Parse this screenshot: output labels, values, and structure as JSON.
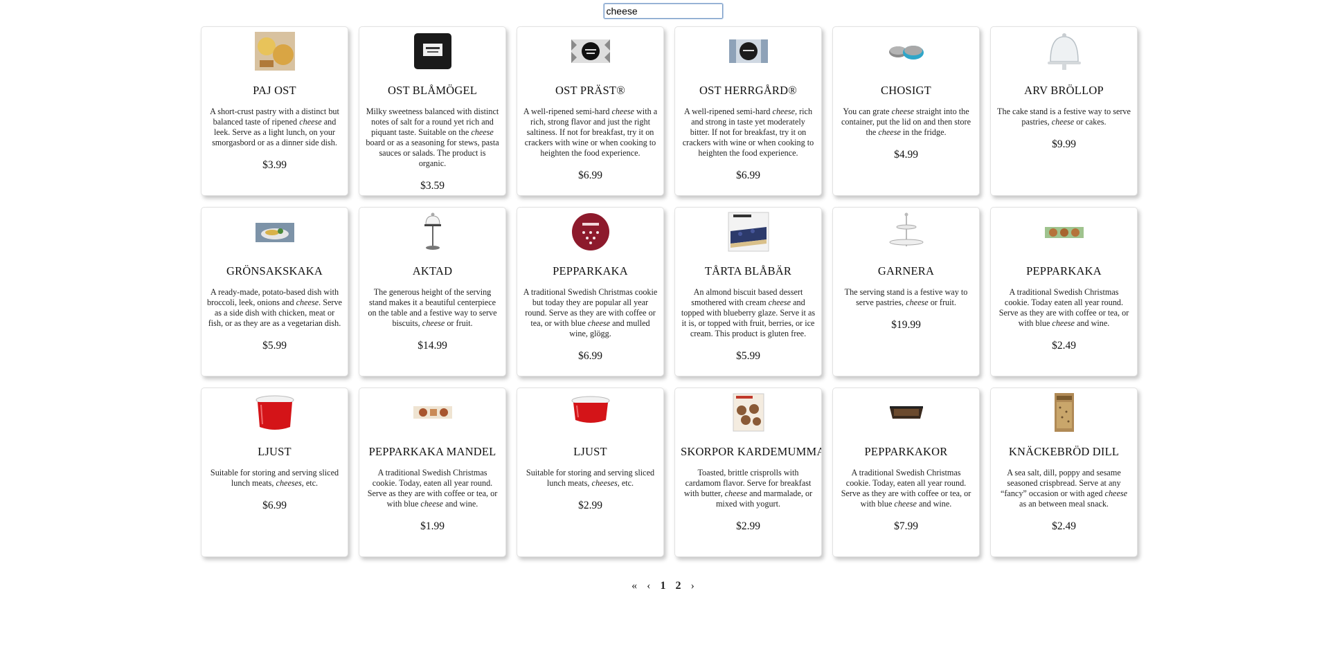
{
  "search": {
    "value": "cheese"
  },
  "products": [
    {
      "title": "PAJ OST",
      "price": "$3.99",
      "icon": "quiche-image",
      "desc": [
        [
          "A short-crust pastry with a distinct but balanced taste of ripened ",
          false
        ],
        [
          "cheese",
          true
        ],
        [
          " and leek. Serve as a light lunch, on your smorgasbord or as a dinner side dish.",
          false
        ]
      ]
    },
    {
      "title": "OST BLÅMÖGEL",
      "price": "$3.59",
      "icon": "blue-cheese-package-image",
      "desc": [
        [
          "Milky sweetness balanced with distinct notes of salt for a round yet rich and piquant taste. Suitable on the ",
          false
        ],
        [
          "cheese",
          true
        ],
        [
          " board or as a seasoning for stews, pasta sauces or salads. The product is organic.",
          false
        ]
      ]
    },
    {
      "title": "OST PRÄST®",
      "price": "$6.99",
      "icon": "prast-cheese-package-image",
      "desc": [
        [
          "A well-ripened semi-hard ",
          false
        ],
        [
          "cheese",
          true
        ],
        [
          " with a rich, strong flavor and just the right saltiness. If not for breakfast, try it on crackers with wine or when cooking to heighten the food experience.",
          false
        ]
      ]
    },
    {
      "title": "OST HERRGÅRD®",
      "price": "$6.99",
      "icon": "herrgard-cheese-package-image",
      "desc": [
        [
          "A well-ripened semi-hard ",
          false
        ],
        [
          "cheese",
          true
        ],
        [
          ", rich and strong in taste yet moderately bitter. If not for breakfast, try it on crackers with wine or when cooking to heighten the food experience.",
          false
        ]
      ]
    },
    {
      "title": "CHOSIGT",
      "price": "$4.99",
      "icon": "grater-container-image",
      "desc": [
        [
          "You can grate ",
          false
        ],
        [
          "cheese",
          true
        ],
        [
          " straight into the container, put the lid on and then store the ",
          false
        ],
        [
          "cheese",
          true
        ],
        [
          " in the fridge.",
          false
        ]
      ]
    },
    {
      "title": "ARV BRÖLLOP",
      "price": "$9.99",
      "icon": "cake-stand-dome-image",
      "desc": [
        [
          "The cake stand is a festive way to serve pastries, ",
          false
        ],
        [
          "cheese",
          true
        ],
        [
          " or cakes.",
          false
        ]
      ]
    },
    {
      "title": "GRÖNSAKSKAKA",
      "price": "$5.99",
      "icon": "vegetable-cake-image",
      "desc": [
        [
          "A ready-made, potato-based dish with broccoli, leek, onions and ",
          false
        ],
        [
          "cheese",
          true
        ],
        [
          ". Serve as a side dish with chicken, meat or fish, or as they are as a vegetarian dish.",
          false
        ]
      ]
    },
    {
      "title": "AKTAD",
      "price": "$14.99",
      "icon": "tall-serving-stand-image",
      "desc": [
        [
          "The generous height of the serving stand makes it a beautiful centerpiece on the table and a festive way to serve biscuits, ",
          false
        ],
        [
          "cheese",
          true
        ],
        [
          " or fruit.",
          false
        ]
      ]
    },
    {
      "title": "PEPPARKAKA",
      "price": "$6.99",
      "icon": "pepparkaka-tin-image",
      "desc": [
        [
          "A traditional Swedish Christmas cookie but today they are popular all year round. Serve as they are with coffee or tea, or with blue ",
          false
        ],
        [
          "cheese",
          true
        ],
        [
          " and mulled wine, glögg.",
          false
        ]
      ]
    },
    {
      "title": "TÅRTA BLÅBÄR",
      "price": "$5.99",
      "icon": "blueberry-tart-image",
      "desc": [
        [
          "An almond biscuit based dessert smothered with cream ",
          false
        ],
        [
          "cheese",
          true
        ],
        [
          " and topped with blueberry glaze. Serve it as it is, or topped with fruit, berries, or ice cream. This product is gluten free.",
          false
        ]
      ]
    },
    {
      "title": "GARNERA",
      "price": "$19.99",
      "icon": "two-tier-stand-image",
      "desc": [
        [
          "The serving stand is a festive way to serve pastries, ",
          false
        ],
        [
          "cheese",
          true
        ],
        [
          " or fruit.",
          false
        ]
      ]
    },
    {
      "title": "PEPPARKAKA",
      "price": "$2.49",
      "icon": "pepparkaka-cookies-image",
      "desc": [
        [
          "A traditional Swedish Christmas cookie. Today eaten all year round. Serve as they are with coffee or tea, or with blue ",
          false
        ],
        [
          "cheese",
          true
        ],
        [
          " and wine.",
          false
        ]
      ]
    },
    {
      "title": "LJUST",
      "price": "$6.99",
      "icon": "red-container-image",
      "desc": [
        [
          "Suitable for storing and serving sliced lunch meats, ",
          false
        ],
        [
          "cheeses",
          true
        ],
        [
          ", etc.",
          false
        ]
      ]
    },
    {
      "title": "PEPPARKAKA MANDEL",
      "price": "$1.99",
      "icon": "pepparkaka-mandel-image",
      "desc": [
        [
          "A traditional Swedish Christmas cookie. Today, eaten all year round. Serve as they are with coffee or tea, or with blue ",
          false
        ],
        [
          "cheese",
          true
        ],
        [
          " and wine.",
          false
        ]
      ]
    },
    {
      "title": "LJUST",
      "price": "$2.99",
      "icon": "red-container-small-image",
      "desc": [
        [
          "Suitable for storing and serving sliced lunch meats, ",
          false
        ],
        [
          "cheeses",
          true
        ],
        [
          ", etc.",
          false
        ]
      ]
    },
    {
      "title": "SKORPOR KARDEMUMMA",
      "price": "$2.99",
      "icon": "skorpor-bag-image",
      "desc": [
        [
          "Toasted, brittle crisprolls with cardamom flavor. Serve for breakfast with butter, ",
          false
        ],
        [
          "cheese",
          true
        ],
        [
          " and marmalade, or mixed with yogurt.",
          false
        ]
      ]
    },
    {
      "title": "PEPPARKAKOR",
      "price": "$7.99",
      "icon": "pepparkakor-box-image",
      "desc": [
        [
          "A traditional Swedish Christmas cookie. Today, eaten all year round. Serve as they are with coffee or tea, or with blue ",
          false
        ],
        [
          "cheese",
          true
        ],
        [
          " and wine.",
          false
        ]
      ]
    },
    {
      "title": "KNÄCKEBRÖD DILL",
      "price": "$2.49",
      "icon": "crispbread-package-image",
      "desc": [
        [
          "A sea salt, dill, poppy and sesame seasoned crispbread. Serve at any “fancy” occasion or with aged ",
          false
        ],
        [
          "cheese",
          true
        ],
        [
          " as an between meal snack.",
          false
        ]
      ]
    }
  ],
  "pagination": {
    "first": "«",
    "prev": "‹",
    "pages": [
      "1",
      "2"
    ],
    "next": "›"
  }
}
